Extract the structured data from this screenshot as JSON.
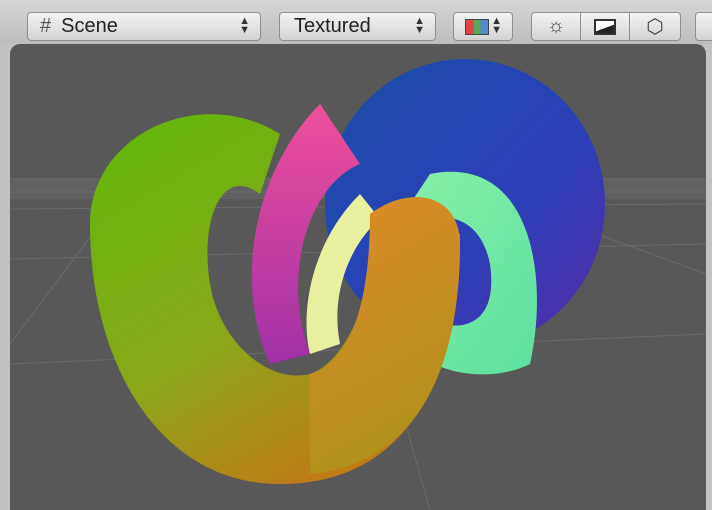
{
  "toolbar": {
    "scene_dropdown": {
      "label": "Scene",
      "icon": "grid-icon"
    },
    "render_mode_dropdown": {
      "label": "Textured"
    },
    "color_dropdown": {
      "icon": "rgb-channels-icon"
    },
    "lighting_toggle": {
      "icon": "sun-icon"
    },
    "skybox_toggle": {
      "icon": "image-icon"
    },
    "gizmo_toggle": {
      "icon": "cube-icon"
    }
  },
  "viewport": {
    "background": "#585858"
  }
}
